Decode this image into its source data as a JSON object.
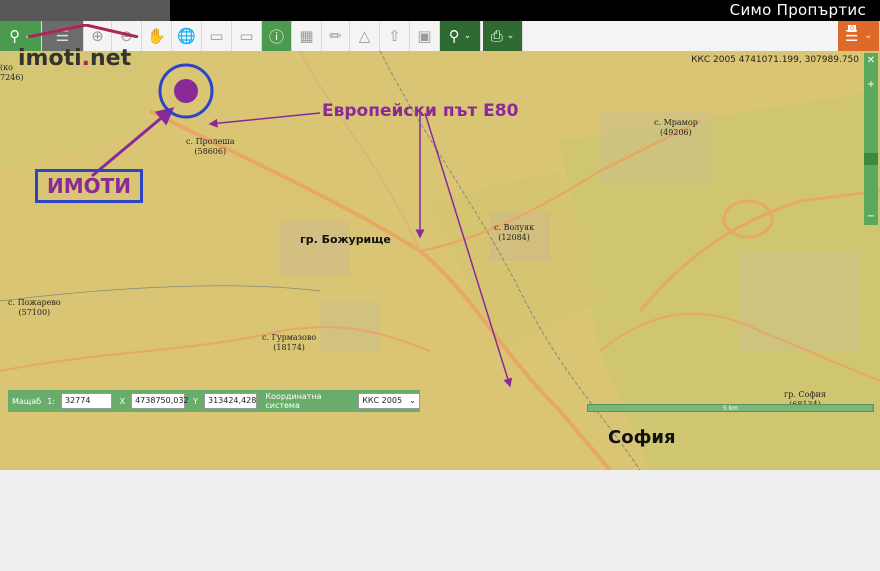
{
  "header": {
    "brand": "Симо Пропъртис"
  },
  "toolbar": {
    "buttons": [
      {
        "icon": "search-icon"
      },
      {
        "icon": "layers-icon"
      },
      {
        "icon": "zoom-in-icon"
      },
      {
        "icon": "zoom-out-icon"
      },
      {
        "icon": "hand-icon"
      },
      {
        "icon": "globe-icon"
      },
      {
        "icon": "window-icon"
      },
      {
        "icon": "window-alt-icon"
      },
      {
        "icon": "info-icon"
      },
      {
        "icon": "select-icon"
      },
      {
        "icon": "ruler-icon"
      },
      {
        "icon": "area-icon"
      },
      {
        "icon": "upload-icon"
      },
      {
        "icon": "crop-icon"
      },
      {
        "icon": "location-icon"
      },
      {
        "icon": "print-icon"
      },
      {
        "icon": "menu-icon"
      }
    ],
    "menu_badge": "0"
  },
  "logo": {
    "text": "imoti",
    "suffix": "net"
  },
  "map": {
    "coord_readout": "ККС 2005 4741071.199, 307989.750",
    "places": [
      {
        "name": "с. Пролеша",
        "code": "(58606)"
      },
      {
        "name": "с. Мрамор",
        "code": "(49206)"
      },
      {
        "name": "с. Волуяк",
        "code": "(12084)"
      },
      {
        "name": "с. Пожарево",
        "code": "(57100)"
      },
      {
        "name": "с. Гурмазово",
        "code": "(18174)"
      },
      {
        "name": "гр. София",
        "code": "(68134)"
      }
    ],
    "partial_code_left": "(ко\n7246)",
    "town_bozhurishte": "гр. Божурище",
    "city_sofia": "София",
    "annotation_road": "Европейски път Е80",
    "annotation_imoti": "ИМОТИ",
    "scale_label": "5 km"
  },
  "coordbar": {
    "scale_label": "Мащаб",
    "scale_prefix": "1:",
    "scale_value": "32774",
    "x_label": "X",
    "x_value": "4738750,032",
    "y_label": "Y",
    "y_value": "313424,428",
    "system_label": "Координатна система",
    "system_value": "ККС 2005"
  },
  "colors": {
    "annotation": "#8a2a99",
    "box_border": "#2b44c9",
    "map_base": "#d9c574",
    "road": "#e8a865"
  }
}
